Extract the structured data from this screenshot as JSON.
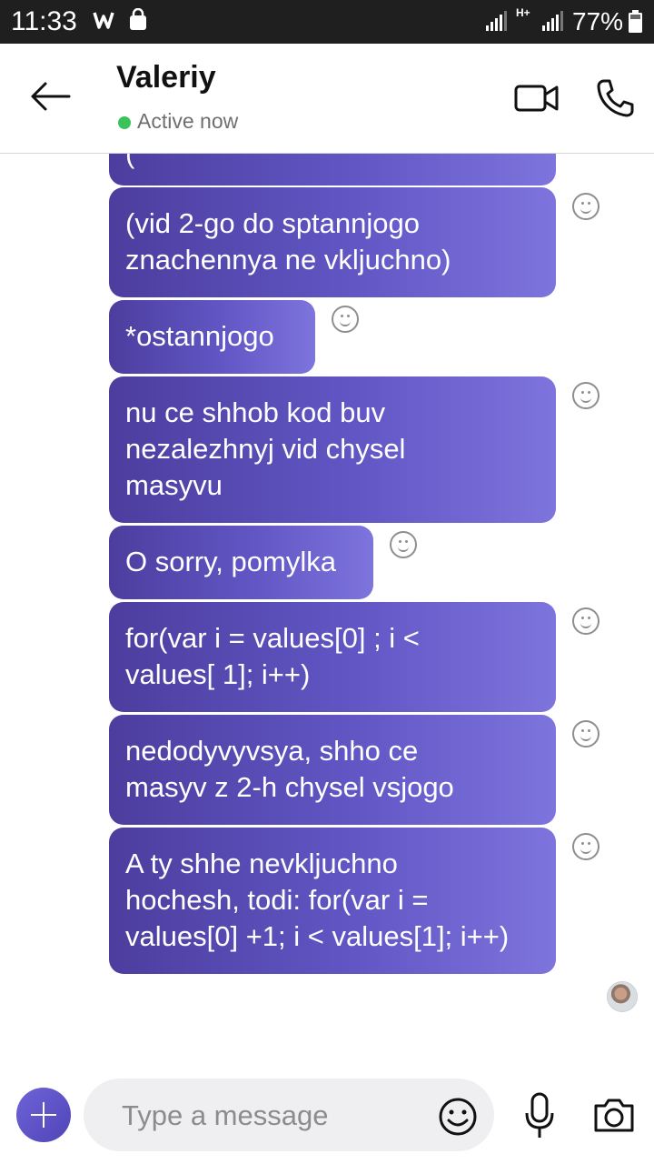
{
  "status_bar": {
    "time": "11:33",
    "network_label": "H+",
    "battery_percent": "77%"
  },
  "header": {
    "contact_name": "Valeriy",
    "presence": "Active now",
    "presence_color": "#3cc25a"
  },
  "messages": [
    {
      "text": "(",
      "sender": "me"
    },
    {
      "text": "(vid 2-go do sptannjogo\nznachennya ne vkljuchno)",
      "sender": "me"
    },
    {
      "text": "*ostannjogo",
      "sender": "me"
    },
    {
      "text": "nu ce shhob kod buv\nnezalezhnyj vid chysel\nmasyvu",
      "sender": "me"
    },
    {
      "text": "O sorry, pomylka",
      "sender": "me"
    },
    {
      "text": "for(var i = values[0] ; i <\nvalues[ 1]; i++)",
      "sender": "me"
    },
    {
      "text": "nedodyvyvsya, shho ce\nmasyv z 2-h chysel vsjogo",
      "sender": "me"
    },
    {
      "text": "A ty shhe nevkljuchno\nhochesh, todi: for(var i =\nvalues[0] +1; i < values[1]; i++)",
      "sender": "me"
    }
  ],
  "composer": {
    "placeholder": "Type a message"
  },
  "icons": {
    "back": "arrow-left-icon",
    "video": "video-camera-icon",
    "call": "phone-icon",
    "add": "plus-icon",
    "emoji": "smiley-icon",
    "mic": "microphone-icon",
    "camera": "camera-icon",
    "reaction": "smiley-reaction-icon"
  },
  "colors": {
    "bubble_start": "#4c3d9e",
    "bubble_end": "#7e74dd",
    "accent": "#6156c4"
  }
}
